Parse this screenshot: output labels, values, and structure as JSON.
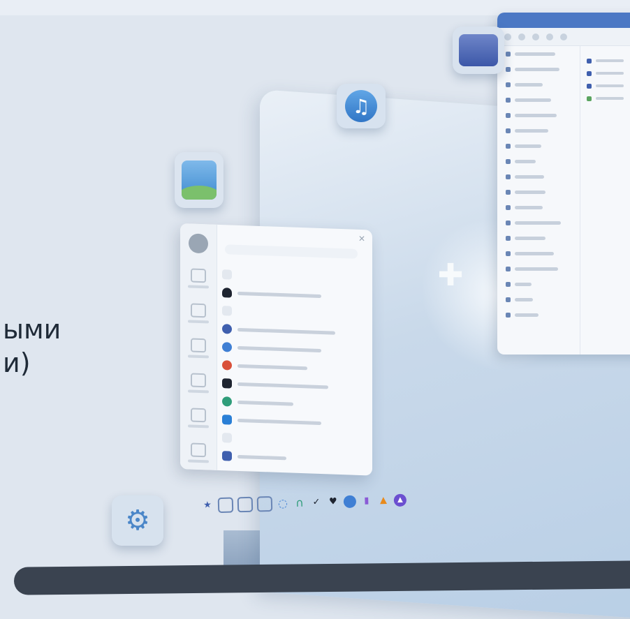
{
  "headline": {
    "line1": "ыми",
    "line2": "и)"
  },
  "file_manager": {
    "sidebar_count": 18,
    "main_rows": 4
  },
  "taskbar": {
    "icons": [
      "star-icon",
      "copy-icon",
      "folder-icon",
      "document-icon",
      "refresh-icon",
      "headphones-icon",
      "bird-icon",
      "heart-icon",
      "browser-icon",
      "gamepad-icon",
      "vlc-icon",
      "assistant-icon"
    ]
  },
  "colors": {
    "accent": "#4b78c4",
    "headline": "#1f2a37",
    "background": "#dfe6ef"
  }
}
